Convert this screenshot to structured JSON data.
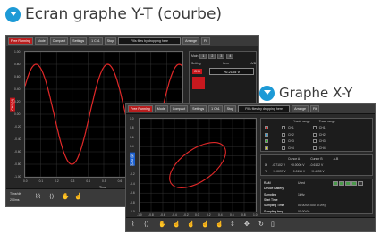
{
  "headings": {
    "yt": "Ecran graphe Y-T (courbe)",
    "xy": "Graphe X-Y"
  },
  "win1": {
    "toolbar": {
      "run": "Free Running",
      "mode": "Mode",
      "compact": "Compact",
      "settings": "Settings",
      "ch": "1 Ch1",
      "stop": "Stop",
      "file": "Fills files by dropping here",
      "arrange": "Arrange",
      "fit": "Fit"
    },
    "yticks": [
      "1.00",
      "0.80",
      "0.60",
      "0.40",
      "0.20",
      "0.00",
      "-0.20",
      "-0.40",
      "-0.60",
      "-0.80",
      "-1.00"
    ],
    "xticks": [
      "0.0",
      "0.1",
      "0.2",
      "0.3",
      "0.4",
      "0.5",
      "0.6",
      "0.7",
      "0.8",
      "0.9",
      "1.0"
    ],
    "xlabel": "Time",
    "ylabel": "CH1 (V)",
    "side": {
      "title": "Main",
      "tabs": [
        "1",
        "2",
        "3",
        "4"
      ],
      "rows": [
        [
          "Setting",
          "Item",
          "A/B"
        ]
      ],
      "channel": "CH1",
      "value": "+0.2105 V"
    },
    "bottom": {
      "label1": "Time/div",
      "label2": "200ms"
    }
  },
  "win2": {
    "toolbar": {
      "run": "Free Running",
      "mode": "Mode",
      "compact": "Compact",
      "settings": "Settings",
      "ch": "1 Ch1",
      "stop": "Stop",
      "file": "Fills files by dropping here",
      "arrange": "Arrange",
      "fit": "Fit"
    },
    "yticks": [
      "1.0",
      "0.8",
      "0.6",
      "0.4",
      "0.2",
      "0.0",
      "-0.2",
      "-0.4",
      "-0.6",
      "-0.8",
      "-1.0"
    ],
    "xticks": [
      "-1.0",
      "-0.8",
      "-0.6",
      "-0.4",
      "-0.2",
      "0.0",
      "0.2",
      "0.4",
      "0.6",
      "0.8",
      "1.0"
    ],
    "ylabel": "CH2 (V)",
    "xlabel": "CH1 (V)",
    "traces": {
      "header": [
        "",
        "Y-axis range",
        "Trace range"
      ],
      "rows": [
        {
          "color": "#e02020",
          "a": "CH1",
          "b": "CH1"
        },
        {
          "color": "#20a0e0",
          "a": "CH2",
          "b": "CH2"
        },
        {
          "color": "#20c020",
          "a": "CH3",
          "b": "CH3"
        },
        {
          "color": "#e0e020",
          "a": "CH4",
          "b": "CH4"
        }
      ]
    },
    "cursor": {
      "header": [
        "Cursor A",
        "Cursor B",
        "A-B"
      ],
      "x": [
        "-0.7102 V",
        "+0.0006 V",
        "-0.6102 V"
      ],
      "y": [
        "+0.0097 V",
        "+0.0116 V",
        "+0.4995 V"
      ]
    },
    "info": {
      "rows": [
        [
          "RAM",
          "Used"
        ],
        [
          "Device Battery",
          ""
        ],
        [
          "Sampling",
          "1kHz"
        ],
        [
          "Start Time",
          ""
        ],
        [
          "Sampling Time",
          "00:00:00.000 (0.0%)"
        ],
        [
          "Sampling freq",
          "00:00:00"
        ]
      ]
    }
  }
}
